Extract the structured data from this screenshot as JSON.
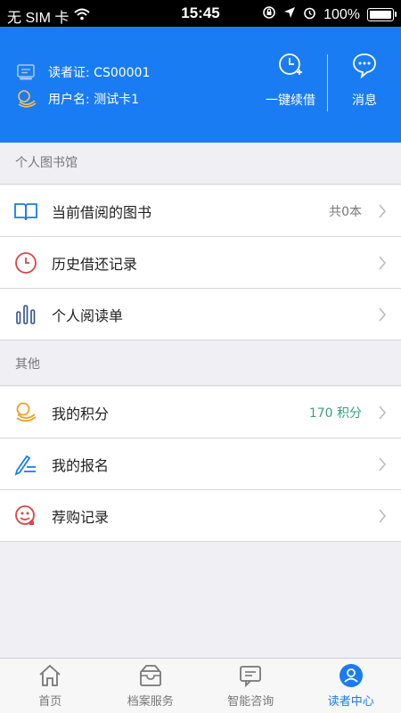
{
  "status_bar": {
    "carrier": "无 SIM 卡",
    "time": "15:45",
    "battery": "100%"
  },
  "header": {
    "reader_id": "读者证: CS00001",
    "username": "用户名: 测试卡1",
    "actions": [
      {
        "label": "一键续借",
        "icon": "clock-plus-icon"
      },
      {
        "label": "消息",
        "icon": "message-icon"
      }
    ],
    "accent": "#1a7cf2"
  },
  "sections": [
    {
      "title": "个人图书馆",
      "items": [
        {
          "label": "当前借阅的图书",
          "value": "共0本",
          "icon": "book-icon",
          "icon_color": "#1a7cf2"
        },
        {
          "label": "历史借还记录",
          "value": "",
          "icon": "clock-icon",
          "icon_color": "#e04343"
        },
        {
          "label": "个人阅读单",
          "value": "",
          "icon": "bar-chart-icon",
          "icon_color": "#2f4f8f"
        }
      ]
    },
    {
      "title": "其他",
      "items": [
        {
          "label": "我的积分",
          "value": "170 积分",
          "icon": "coins-icon",
          "icon_color": "#f0a020",
          "value_color": "#3aa07a"
        },
        {
          "label": "我的报名",
          "value": "",
          "icon": "pen-list-icon",
          "icon_color": "#1a7cf2"
        },
        {
          "label": "荐购记录",
          "value": "",
          "icon": "recommend-icon",
          "icon_color": "#e04343"
        }
      ]
    }
  ],
  "tabbar": [
    {
      "label": "首页",
      "icon": "home-icon",
      "active": false
    },
    {
      "label": "档案服务",
      "icon": "archive-icon",
      "active": false
    },
    {
      "label": "智能咨询",
      "icon": "chat-icon",
      "active": false
    },
    {
      "label": "读者中心",
      "icon": "user-icon",
      "active": true
    }
  ]
}
